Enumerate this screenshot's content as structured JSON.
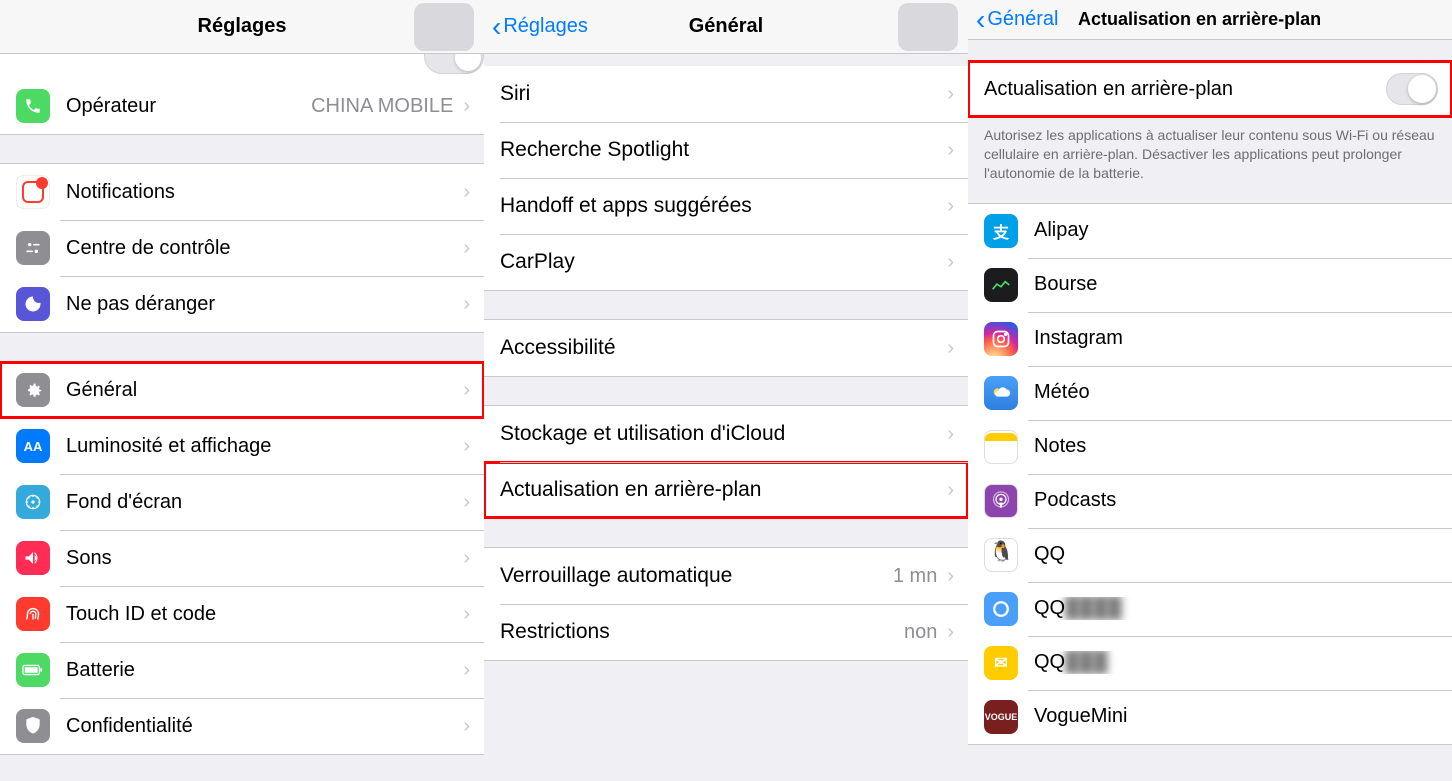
{
  "panel1": {
    "navTitle": "Réglages",
    "rows": {
      "operator": {
        "label": "Opérateur",
        "value": "CHINA MOBILE"
      },
      "notifications": {
        "label": "Notifications"
      },
      "control": {
        "label": "Centre de contrôle"
      },
      "dnd": {
        "label": "Ne pas déranger"
      },
      "general": {
        "label": "Général"
      },
      "display": {
        "label": "Luminosité et affichage"
      },
      "wallpaper": {
        "label": "Fond d'écran"
      },
      "sounds": {
        "label": "Sons"
      },
      "touchid": {
        "label": "Touch ID et code"
      },
      "battery": {
        "label": "Batterie"
      },
      "privacy": {
        "label": "Confidentialité"
      }
    }
  },
  "panel2": {
    "back": "Réglages",
    "navTitle": "Général",
    "rows": {
      "siri": "Siri",
      "spotlight": "Recherche Spotlight",
      "handoff": "Handoff et apps suggérées",
      "carplay": "CarPlay",
      "accessibility": "Accessibilité",
      "storage": "Stockage et utilisation d'iCloud",
      "refresh": "Actualisation en arrière-plan",
      "autolock": {
        "label": "Verrouillage automatique",
        "value": "1 mn"
      },
      "restrictions": {
        "label": "Restrictions",
        "value": "non"
      }
    }
  },
  "panel3": {
    "back": "Général",
    "navTitle": "Actualisation en arrière-plan",
    "master": "Actualisation en arrière-plan",
    "footnote": "Autorisez les applications à actualiser leur contenu sous Wi-Fi ou réseau cellulaire en arrière-plan. Désactiver les applications peut prolonger l'autonomie de la batterie.",
    "apps": {
      "alipay": "Alipay",
      "bourse": "Bourse",
      "instagram": "Instagram",
      "meteo": "Météo",
      "notes": "Notes",
      "podcasts": "Podcasts",
      "qq1": "QQ",
      "qq2": "QQ",
      "qq3": "QQ",
      "vogue": "VogueMini"
    }
  }
}
